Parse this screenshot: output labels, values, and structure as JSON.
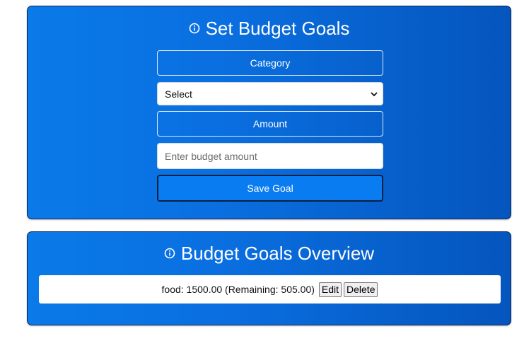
{
  "setGoals": {
    "title": "Set Budget Goals",
    "category_label": "Category",
    "category_select_value": "Select",
    "amount_label": "Amount",
    "amount_placeholder": "Enter budget amount",
    "save_label": "Save Goal"
  },
  "overview": {
    "title": "Budget Goals Overview",
    "goals": [
      {
        "text": "food: 1500.00 (Remaining: 505.00)",
        "edit_label": "Edit",
        "delete_label": "Delete"
      }
    ]
  },
  "icons": {
    "title_icon": "info-circle-icon",
    "select_icon": "chevron-down-icon"
  },
  "colors": {
    "card_gradient_start": "#0a7ae8",
    "card_gradient_end": "#0555bd",
    "save_button": "#0a7cf2"
  }
}
